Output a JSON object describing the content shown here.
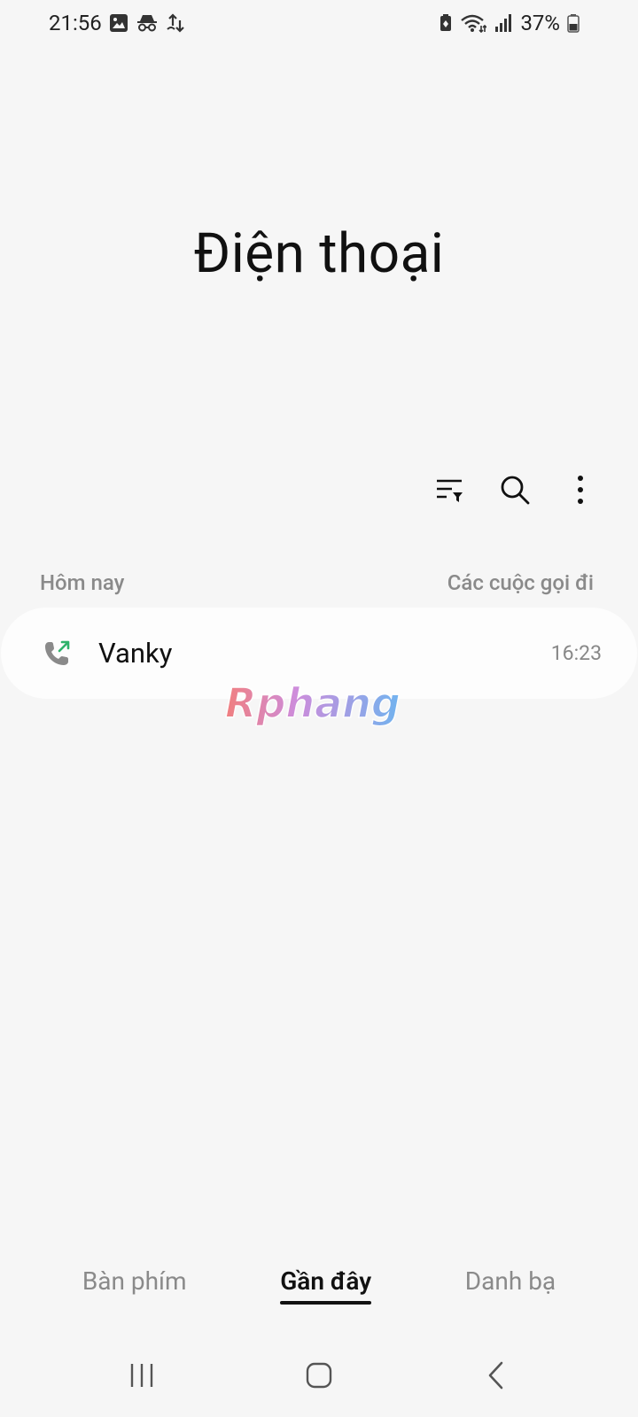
{
  "status_bar": {
    "time": "21:56",
    "battery_percent": "37%",
    "left_icons": [
      "gallery-icon",
      "incognito-icon",
      "transfer-icon"
    ],
    "right_icons": [
      "battery-saver-icon",
      "wifi-icon",
      "signal-icon",
      "battery-icon"
    ]
  },
  "header": {
    "title": "Điện thoại"
  },
  "toolbar": {
    "icons": [
      "filter-icon",
      "search-icon",
      "more-options-icon"
    ]
  },
  "section": {
    "left_label": "Hôm nay",
    "right_label": "Các cuộc gọi đi"
  },
  "calls": [
    {
      "name": "Vanky",
      "time": "16:23",
      "type": "outgoing"
    }
  ],
  "tabs": [
    {
      "label": "Bàn phím",
      "active": false
    },
    {
      "label": "Gần đây",
      "active": true
    },
    {
      "label": "Danh bạ",
      "active": false
    }
  ],
  "watermark": {
    "text": "Rphang"
  },
  "nav_bar": {
    "icons": [
      "recents-icon",
      "home-icon",
      "back-icon"
    ]
  },
  "colors": {
    "background": "#f6f6f6",
    "card": "#fdfdfd",
    "outgoing_arrow": "#2fb36b",
    "muted_text": "#8a8a8a"
  }
}
